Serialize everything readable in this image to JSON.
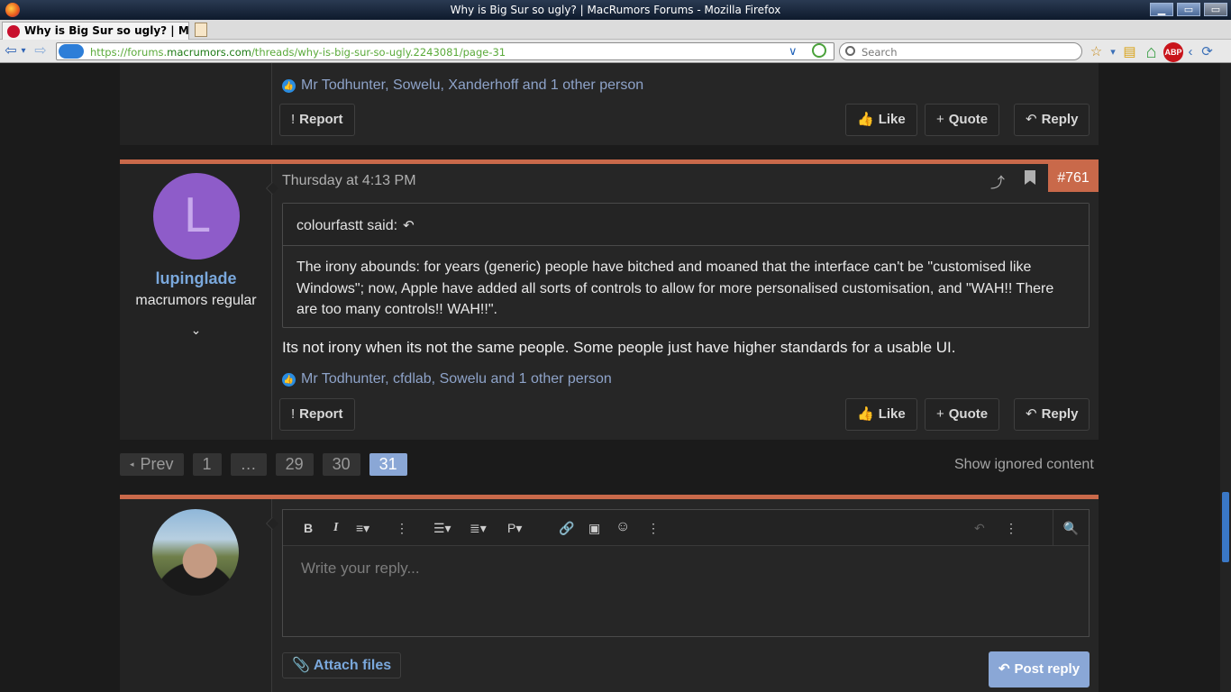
{
  "window": {
    "title": "Why is Big Sur so ugly? | MacRumors Forums - Mozilla Firefox",
    "min_glyph": "▁",
    "max_glyph": "▭",
    "close_glyph": "▭"
  },
  "tab": {
    "title": "Why is Big Sur so ugly? | M...",
    "close_glyph": "×"
  },
  "nav": {
    "back_glyph": "⇦",
    "dd_glyph": "▾",
    "forward_glyph": "⇨",
    "url_prefix": "https://forums.",
    "url_host": "macrumors.com",
    "url_path": "/threads/why-is-big-sur-so-ugly.2243081/page-31",
    "url_dropdown_glyph": "∨",
    "search_placeholder": "Search",
    "toolbar_icons": {
      "star": "☆",
      "star_dd": "▾",
      "bookmarks": "▤",
      "home": "⌂",
      "abp": "ABP",
      "chevron": "‹",
      "sync": "⟳"
    }
  },
  "posts": [
    {
      "reactions_icon": "👍",
      "reactions": "Mr Todhunter, Sowelu, Xanderhoff and 1 other person",
      "report_label": "Report",
      "like_label": "Like",
      "quote_label": "Quote",
      "reply_label": "Reply"
    },
    {
      "avatar_letter": "L",
      "username": "lupinglade",
      "user_title": "macrumors regular",
      "user_expand_glyph": "⌄",
      "date": "Thursday at 4:13 PM",
      "share_glyph": "⤴",
      "post_number": "#761",
      "quote": {
        "author": "colourfastt said:",
        "jump_glyph": "↶",
        "text": "The irony abounds: for years (generic) people have bitched and moaned that the interface can't be \"customised like Windows\"; now, Apple have added all sorts of controls to allow for more personalised customisation, and \"WAH!! There are too many controls!! WAH!!\"."
      },
      "body": "Its not irony when its not the same people. Some people just have higher standards for a usable UI.",
      "reactions_icon": "👍",
      "reactions": "Mr Todhunter, cfdlab, Sowelu and 1 other person",
      "report_label": "Report",
      "like_label": "Like",
      "quote_label": "Quote",
      "reply_label": "Reply"
    }
  ],
  "icons": {
    "report": "!",
    "like": "👍",
    "quote": "+",
    "reply": "↶"
  },
  "pagination": {
    "prev_arrow": "◂",
    "prev_label": "Prev",
    "pages": [
      "1",
      "…",
      "29",
      "30",
      "31"
    ],
    "current": "31",
    "show_ignored": "Show ignored content"
  },
  "editor": {
    "toolbar": {
      "bold": "B",
      "italic": "I",
      "font_size": "≡▾",
      "more1": "⋮",
      "list": "☰▾",
      "align": "≣▾",
      "paragraph": "P▾",
      "link": "🔗",
      "image": "▣",
      "emoji": "☺",
      "more2": "⋮",
      "undo": "↶",
      "more3": "⋮",
      "preview": "🔍"
    },
    "placeholder": "Write your reply...",
    "attach_icon": "📎",
    "attach_label": "Attach files",
    "post_reply_icon": "↶",
    "post_reply_label": "Post reply"
  },
  "colors": {
    "accent": "#c9694a",
    "link": "#7aa8dc",
    "button_primary": "#8aa7d6",
    "avatar_purple": "#8e5cc9"
  }
}
